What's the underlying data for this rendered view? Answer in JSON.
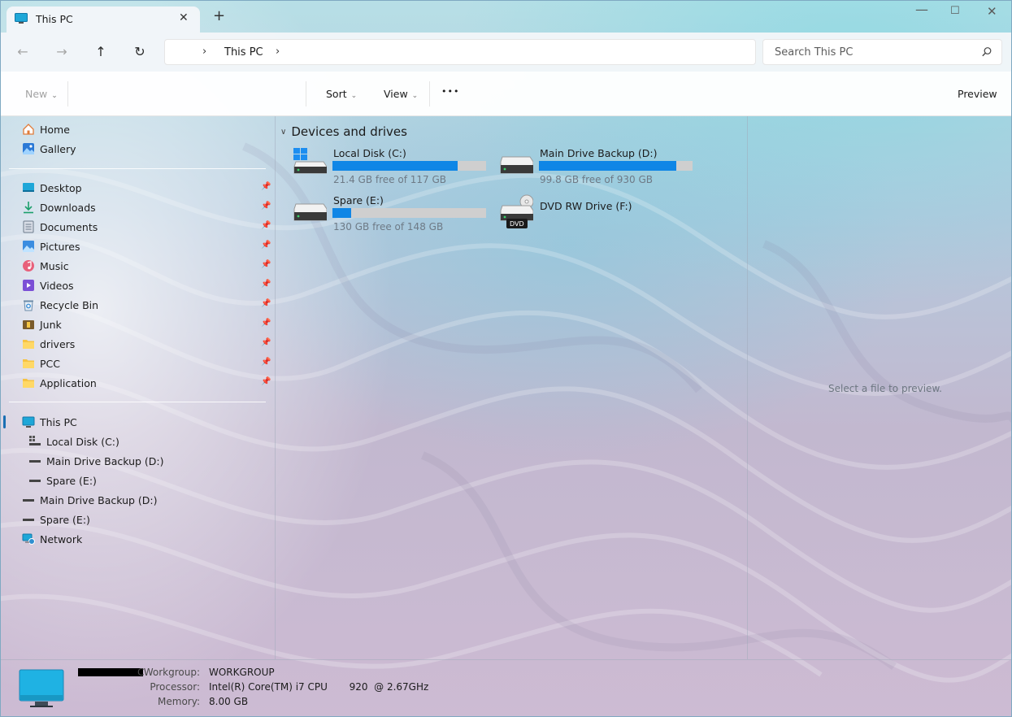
{
  "window": {
    "tab_title": "This PC",
    "new_tab": "+",
    "close_tab": "✕",
    "minimize": "—",
    "maximize": "☐",
    "close": "✕"
  },
  "navigation": {
    "back": "←",
    "forward": "→",
    "up": "↑",
    "refresh": "↻",
    "breadcrumb": [
      "This PC"
    ],
    "search_placeholder": "Search This PC"
  },
  "command_bar": {
    "new_label": "New",
    "sort_label": "Sort",
    "view_label": "View",
    "more_label": "•••",
    "preview_label": "Preview"
  },
  "sidebar": {
    "top_items": [
      {
        "label": "Home",
        "icon": "home-icon"
      },
      {
        "label": "Gallery",
        "icon": "gallery-icon"
      }
    ],
    "quick_access": [
      {
        "label": "Desktop",
        "icon": "desktop-icon"
      },
      {
        "label": "Downloads",
        "icon": "download-icon"
      },
      {
        "label": "Documents",
        "icon": "documents-icon"
      },
      {
        "label": "Pictures",
        "icon": "pictures-icon"
      },
      {
        "label": "Music",
        "icon": "music-icon"
      },
      {
        "label": "Videos",
        "icon": "videos-icon"
      },
      {
        "label": "Recycle Bin",
        "icon": "recycle-bin-icon"
      },
      {
        "label": "Junk",
        "icon": "junk-icon"
      },
      {
        "label": "drivers",
        "icon": "folder-icon"
      },
      {
        "label": "PCC",
        "icon": "folder-icon"
      },
      {
        "label": "Application",
        "icon": "folder-icon"
      }
    ],
    "this_pc": {
      "label": "This PC",
      "icon": "computer-icon"
    },
    "this_pc_children": [
      {
        "label": "Local Disk (C:)",
        "icon": "windows-drive-icon"
      },
      {
        "label": "Main Drive Backup (D:)",
        "icon": "drive-icon"
      },
      {
        "label": "Spare (E:)",
        "icon": "drive-icon"
      }
    ],
    "bottom_items": [
      {
        "label": "Main Drive Backup (D:)",
        "icon": "drive-icon"
      },
      {
        "label": "Spare (E:)",
        "icon": "drive-icon"
      },
      {
        "label": "Network",
        "icon": "network-icon"
      }
    ]
  },
  "main": {
    "group_title": "Devices and drives",
    "drives": [
      {
        "name": "Local Disk (C:)",
        "free_text": "21.4 GB free of 117 GB",
        "used_fraction": 0.817,
        "icon": "windows-drive-icon"
      },
      {
        "name": "Main Drive Backup (D:)",
        "free_text": "99.8 GB free of 930 GB",
        "used_fraction": 0.893,
        "icon": "drive-icon"
      },
      {
        "name": "Spare (E:)",
        "free_text": "130 GB free of 148 GB",
        "used_fraction": 0.122,
        "icon": "drive-icon"
      },
      {
        "name": "DVD RW Drive (F:)",
        "icon": "dvd-drive-icon",
        "badge": "DVD"
      }
    ],
    "accent_color": "#0f86e6"
  },
  "preview": {
    "empty_text": "Select a file to preview."
  },
  "details": {
    "workgroup_label": "Workgroup:",
    "workgroup_value": "WORKGROUP",
    "processor_label": "Processor:",
    "processor_value": "Intel(R) Core(TM) i7 CPU       920  @ 2.67GHz",
    "memory_label": "Memory:",
    "memory_value": "8.00 GB",
    "pc_name_suffix": "C"
  }
}
